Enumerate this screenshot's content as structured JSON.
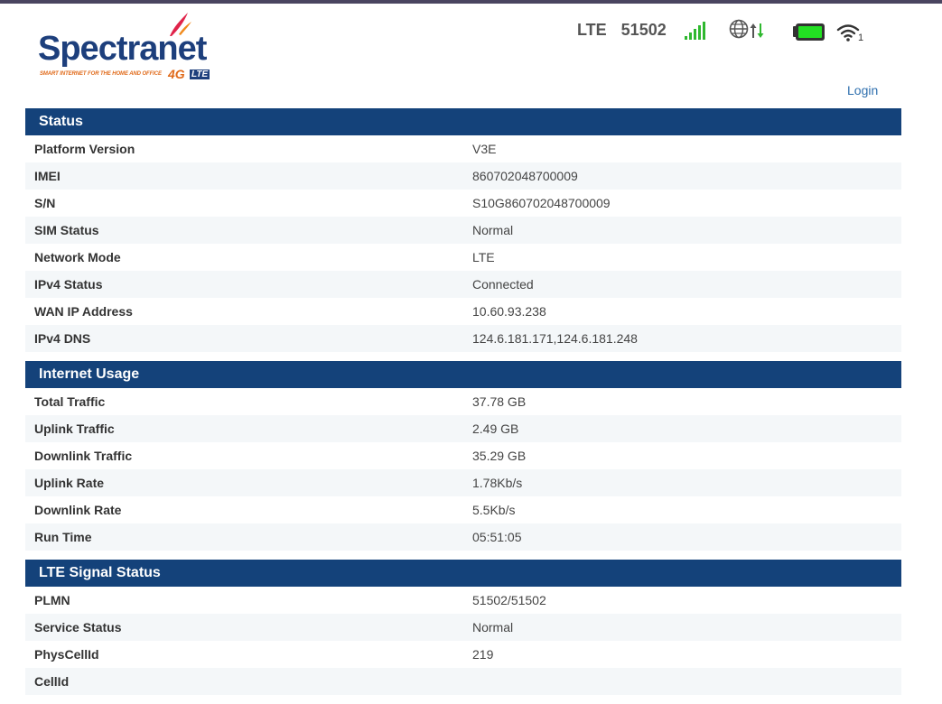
{
  "brand": {
    "name": "Spectranet",
    "tagline": "SMART INTERNET FOR THE HOME AND OFFICE",
    "badge_4g": "4G",
    "badge_lte": "LTE"
  },
  "statusbar": {
    "network_type": "LTE",
    "plmn": "51502",
    "signal_bars": 5,
    "wifi_clients": "1",
    "icons": [
      "signal-icon",
      "globe-data-icon",
      "battery-icon",
      "wifi-icon"
    ]
  },
  "header": {
    "login_label": "Login"
  },
  "colors": {
    "section_header": "#14427a",
    "signal_green": "#2fb82f",
    "battery_green": "#22e022",
    "link_blue": "#2e6fae"
  },
  "sections": {
    "status": {
      "title": "Status",
      "rows": [
        {
          "label": "Platform Version",
          "value": "V3E"
        },
        {
          "label": "IMEI",
          "value": "860702048700009"
        },
        {
          "label": "S/N",
          "value": "S10G860702048700009"
        },
        {
          "label": "SIM Status",
          "value": "Normal"
        },
        {
          "label": "Network Mode",
          "value": "LTE"
        },
        {
          "label": "IPv4 Status",
          "value": "Connected"
        },
        {
          "label": "WAN IP Address",
          "value": "10.60.93.238"
        },
        {
          "label": "IPv4 DNS",
          "value": "124.6.181.171,124.6.181.248"
        }
      ]
    },
    "usage": {
      "title": "Internet Usage",
      "rows": [
        {
          "label": "Total Traffic",
          "value": "37.78 GB"
        },
        {
          "label": "Uplink Traffic",
          "value": "2.49 GB"
        },
        {
          "label": "Downlink Traffic",
          "value": "35.29 GB"
        },
        {
          "label": "Uplink Rate",
          "value": "1.78Kb/s"
        },
        {
          "label": "Downlink Rate",
          "value": "5.5Kb/s"
        },
        {
          "label": "Run Time",
          "value": "05:51:05"
        }
      ]
    },
    "lte": {
      "title": "LTE Signal Status",
      "rows": [
        {
          "label": "PLMN",
          "value": "51502/51502"
        },
        {
          "label": "Service Status",
          "value": "Normal"
        },
        {
          "label": "PhysCellId",
          "value": "219"
        },
        {
          "label": "CellId",
          "value": ""
        }
      ]
    }
  }
}
